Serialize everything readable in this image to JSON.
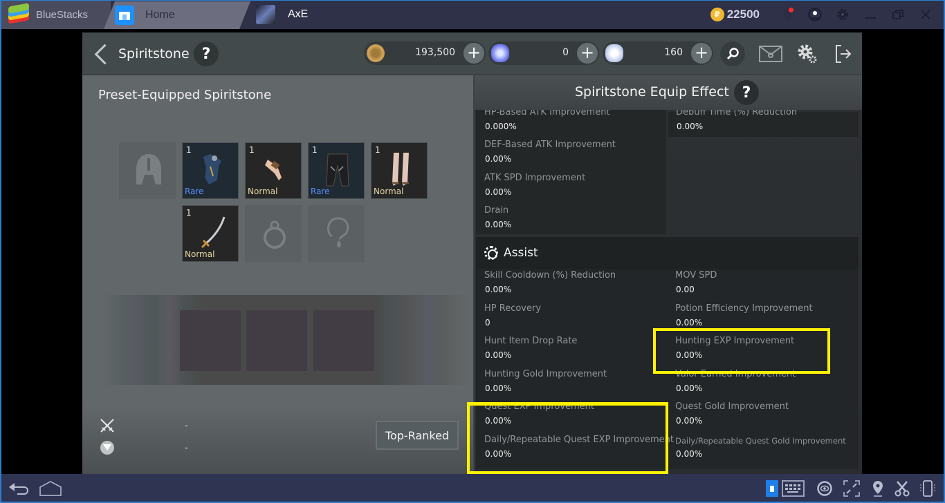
{
  "titlebar": {
    "app_name": "BlueStacks",
    "tabs": [
      {
        "label": "Home",
        "icon": "home-icon"
      },
      {
        "label": "AxE",
        "icon": "axe-game-icon"
      }
    ],
    "coins": "22500",
    "coin_symbol": "₽",
    "icons": [
      "coin-icon",
      "bell-icon",
      "profile-icon",
      "gear-icon",
      "minimize-icon",
      "restore-icon",
      "close-icon"
    ]
  },
  "game_header": {
    "title": "Spiritstone",
    "help": "?",
    "currencies": [
      {
        "name": "gold",
        "value": "193,500"
      },
      {
        "name": "blue-gem",
        "value": "0"
      },
      {
        "name": "white-gem",
        "value": "160"
      }
    ],
    "plus": "+",
    "icons": [
      "search-icon",
      "mail-icon",
      "settings-icon",
      "exit-icon"
    ]
  },
  "left_panel": {
    "title": "Preset-Equipped Spiritstone",
    "slots": [
      {
        "type": "helmet",
        "empty": true,
        "count": "",
        "grade": ""
      },
      {
        "type": "armor",
        "empty": false,
        "count": "1",
        "grade": "Rare"
      },
      {
        "type": "gloves",
        "empty": false,
        "count": "1",
        "grade": "Normal"
      },
      {
        "type": "pants",
        "empty": false,
        "count": "1",
        "grade": "Rare"
      },
      {
        "type": "boots",
        "empty": false,
        "count": "1",
        "grade": "Normal"
      },
      {
        "type": "weapon",
        "empty": false,
        "count": "1",
        "grade": "Normal"
      },
      {
        "type": "ring",
        "empty": true,
        "count": "",
        "grade": ""
      },
      {
        "type": "necklace",
        "empty": true,
        "count": "",
        "grade": ""
      }
    ],
    "stats": [
      {
        "icon": "crossed-swords-icon",
        "value": "-"
      },
      {
        "icon": "shield-crest-icon",
        "value": "-"
      }
    ],
    "top_ranked_label": "Top-Ranked"
  },
  "right_panel": {
    "title": "Spiritstone Equip Effect",
    "help": "?",
    "attack_stats": [
      {
        "label": "HP-Based ATK Improvement",
        "value": "0.000%"
      },
      {
        "label": "DEF-Based ATK Improvement",
        "value": "0.00%"
      },
      {
        "label": "ATK SPD Improvement",
        "value": "0.00%"
      },
      {
        "label": "Drain",
        "value": "0.00%"
      }
    ],
    "attack_stats_right": [
      {
        "label": "Debuff Time (%) Reduction",
        "value": "0.00%"
      }
    ],
    "assist_title": "Assist",
    "assist_stats": [
      {
        "label": "Skill Cooldown (%) Reduction",
        "value": "0.00%"
      },
      {
        "label": "MOV SPD",
        "value": "0.00"
      },
      {
        "label": "HP Recovery",
        "value": "0"
      },
      {
        "label": "Potion Efficiency Improvement",
        "value": "0.00%"
      },
      {
        "label": "Hunt Item Drop Rate",
        "value": "0.00%"
      },
      {
        "label": "Hunting EXP Improvement",
        "value": "0.00%"
      },
      {
        "label": "Hunting Gold Improvement",
        "value": "0.00%"
      },
      {
        "label": "Valor Earned Improvement",
        "value": "0.00%"
      },
      {
        "label": "Quest EXP Improvement",
        "value": "0.00%"
      },
      {
        "label": "Quest Gold Improvement",
        "value": "0.00%"
      },
      {
        "label": "Daily/Repeatable Quest EXP Improvement",
        "value": "0.00%"
      },
      {
        "label": "Daily/Repeatable Quest Gold Improvement",
        "value": "0.00%"
      }
    ],
    "highlight_color": "#fff200"
  },
  "navbar": {
    "left": [
      "back-icon",
      "home-icon"
    ],
    "right": [
      "lock-icon",
      "keyboard-icon",
      "eye-icon",
      "fullscreen-icon",
      "location-icon",
      "scissors-icon",
      "rotate-phone-icon"
    ]
  }
}
